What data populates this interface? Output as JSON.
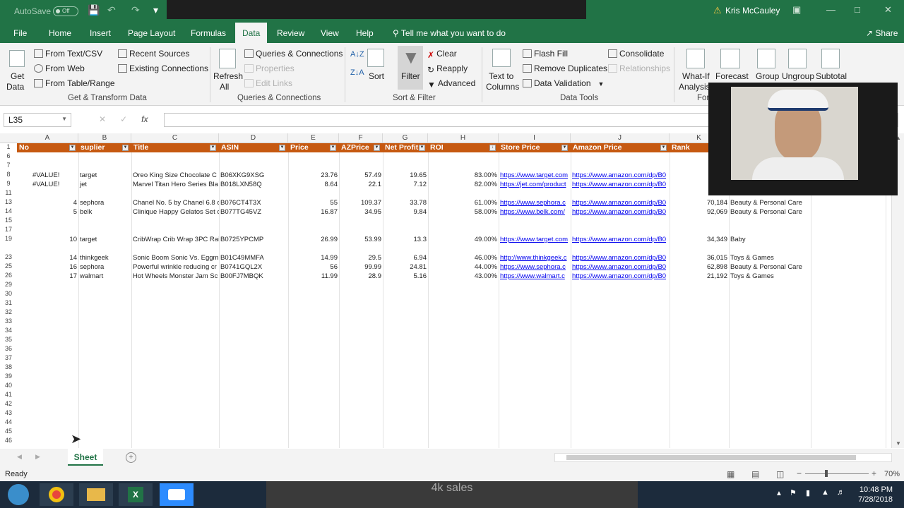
{
  "titlebar": {
    "autosave_label": "AutoSave",
    "autosave_state": "Off",
    "user_name": "Kris McCauley"
  },
  "tabs": [
    "File",
    "Home",
    "Insert",
    "Page Layout",
    "Formulas",
    "Data",
    "Review",
    "View",
    "Help"
  ],
  "active_tab": "Data",
  "tell_me": "Tell me what you want to do",
  "share_label": "Share",
  "ribbon": {
    "get_data": "Get",
    "get_data2": "Data",
    "from_text_csv": "From Text/CSV",
    "from_web": "From Web",
    "from_table_range": "From Table/Range",
    "recent_sources": "Recent Sources",
    "existing_connections": "Existing Connections",
    "group_get_transform": "Get & Transform Data",
    "refresh_all": "Refresh",
    "refresh_all2": "All",
    "queries_connections": "Queries & Connections",
    "properties": "Properties",
    "edit_links": "Edit Links",
    "group_queries": "Queries & Connections",
    "sort": "Sort",
    "filter": "Filter",
    "clear": "Clear",
    "reapply": "Reapply",
    "advanced": "Advanced",
    "group_sort_filter": "Sort & Filter",
    "text_to_columns": "Text to",
    "text_to_columns2": "Columns",
    "flash_fill": "Flash Fill",
    "remove_duplicates": "Remove Duplicates",
    "data_validation": "Data Validation",
    "consolidate": "Consolidate",
    "relationships": "Relationships",
    "group_data_tools": "Data Tools",
    "what_if": "What-If",
    "what_if2": "Analysis",
    "forecast": "Forecast",
    "group_forecast": "For",
    "group": "Group",
    "ungroup": "Ungroup",
    "subtotal": "Subtotal"
  },
  "formula_bar": {
    "name_box": "L35",
    "fx": "fx",
    "value": ""
  },
  "columns": [
    "A",
    "B",
    "C",
    "D",
    "E",
    "F",
    "G",
    "H",
    "I",
    "J",
    "K"
  ],
  "headers": [
    "No",
    "suplier",
    "Title",
    "ASIN",
    "Price",
    "AZPrice",
    "Net Profit",
    "ROI",
    "Store Price",
    "Amazon Price",
    "Rank"
  ],
  "row_numbers": [
    "1",
    "6",
    "7",
    "8",
    "9",
    "11",
    "13",
    "14",
    "15",
    "17",
    "19",
    "23",
    "25",
    "26",
    "29",
    "30",
    "31",
    "32",
    "33",
    "34",
    "35",
    "36",
    "37",
    "38",
    "39",
    "40",
    "41",
    "42",
    "43",
    "44",
    "45",
    "46"
  ],
  "rows": [
    {
      "row": "8",
      "no": "#VALUE!",
      "supplier": "target",
      "title": "Oreo King Size Chocolate C",
      "asin": "B06XKG9XSG",
      "price": "23.76",
      "azprice": "57.49",
      "net": "19.65",
      "roi": "83.00%",
      "store": "https://www.target.com",
      "amazon": "https://www.amazon.com/dp/B0",
      "rank": "",
      "category": ""
    },
    {
      "row": "9",
      "no": "#VALUE!",
      "supplier": "jet",
      "title": "Marvel Titan Hero Series Bla",
      "asin": "B018LXN58Q",
      "price": "8.64",
      "azprice": "22.1",
      "net": "7.12",
      "roi": "82.00%",
      "store": "https://jet.com/product",
      "amazon": "https://www.amazon.com/dp/B0",
      "rank": "",
      "category": ""
    },
    {
      "row": "13",
      "no": "4",
      "supplier": "sephora",
      "title": "Chanel No. 5 by Chanel 6.8 c",
      "asin": "B076CT4T3X",
      "price": "55",
      "azprice": "109.37",
      "net": "33.78",
      "roi": "61.00%",
      "store": "https://www.sephora.c",
      "amazon": "https://www.amazon.com/dp/B0",
      "rank": "70,184",
      "category": "Beauty & Personal Care"
    },
    {
      "row": "14",
      "no": "5",
      "supplier": "belk",
      "title": "Clinique Happy Gelatos Set c",
      "asin": "B077TG45VZ",
      "price": "16.87",
      "azprice": "34.95",
      "net": "9.84",
      "roi": "58.00%",
      "store": "https://www.belk.com/",
      "amazon": "https://www.amazon.com/dp/B0",
      "rank": "92,069",
      "category": "Beauty & Personal Care"
    },
    {
      "row": "19",
      "no": "10",
      "supplier": "target",
      "title": "CribWrap Crib Wrap 3PC Rail",
      "asin": "B0725YPCMP",
      "price": "26.99",
      "azprice": "53.99",
      "net": "13.3",
      "roi": "49.00%",
      "store": "https://www.target.com",
      "amazon": "https://www.amazon.com/dp/B0",
      "rank": "34,349",
      "category": "Baby"
    },
    {
      "row": "23",
      "no": "14",
      "supplier": "thinkgeek",
      "title": "Sonic Boom Sonic Vs. Eggm",
      "asin": "B01C49MMFA",
      "price": "14.99",
      "azprice": "29.5",
      "net": "6.94",
      "roi": "46.00%",
      "store": "http://www.thinkgeek.c",
      "amazon": "https://www.amazon.com/dp/B0",
      "rank": "36,015",
      "category": "Toys & Games"
    },
    {
      "row": "25",
      "no": "16",
      "supplier": "sephora",
      "title": "Powerful wrinkle reducing cr",
      "asin": "B0741GQL2X",
      "price": "56",
      "azprice": "99.99",
      "net": "24.81",
      "roi": "44.00%",
      "store": "https://www.sephora.c",
      "amazon": "https://www.amazon.com/dp/B0",
      "rank": "62,898",
      "category": "Beauty & Personal Care"
    },
    {
      "row": "26",
      "no": "17",
      "supplier": "walmart",
      "title": "Hot Wheels Monster Jam Sc",
      "asin": "B00FJ7MBQK",
      "price": "11.99",
      "azprice": "28.9",
      "net": "5.16",
      "roi": "43.00%",
      "store": "https://www.walmart.c",
      "amazon": "https://www.amazon.com/dp/B0",
      "rank": "21,192",
      "category": "Toys & Games"
    }
  ],
  "sheet_tab": "Sheet",
  "status": "Ready",
  "zoom": "70%",
  "taskbar": {
    "overlay_text": "4k sales",
    "time": "10:48 PM",
    "date": "7/28/2018"
  },
  "colors": {
    "excel_green": "#217346",
    "header_fill": "#c65911"
  }
}
